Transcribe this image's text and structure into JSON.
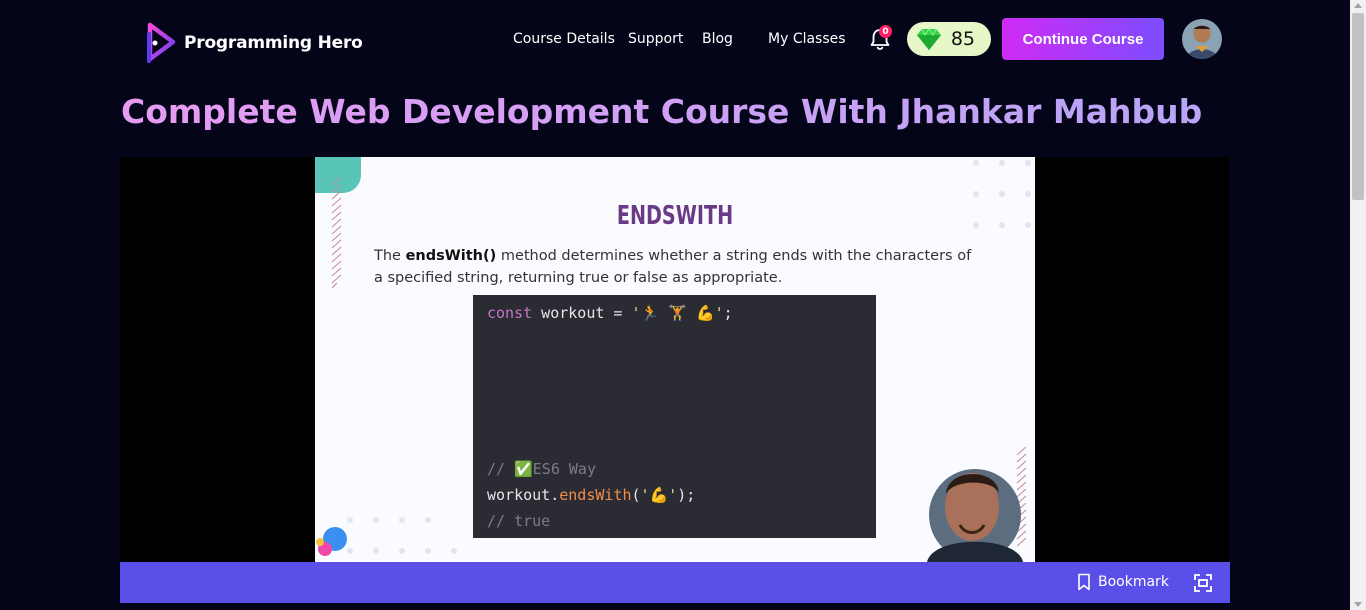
{
  "brand": {
    "name": "Programming Hero"
  },
  "nav": {
    "links": [
      "Course Details",
      "Support",
      "Blog",
      "My Classes"
    ],
    "notification_count": "0",
    "gem_count": "85",
    "continue_label": "Continue Course"
  },
  "page": {
    "title": "Complete Web Development Course With Jhankar Mahbub"
  },
  "slide": {
    "heading": "ENDSWITH",
    "desc_prefix": "The ",
    "desc_method": "endsWith()",
    "desc_rest": " method determines whether a string ends with the characters of a specified string, returning true or false as appropriate.",
    "code": {
      "line1_kw": "const",
      "line1_var": " workout = ",
      "line1_str": "'🏃 🏋 💪'",
      "line1_end": ";",
      "comment1": "// ✅ES6 Way",
      "line2_obj": "workout.",
      "line2_fn": "endsWith",
      "line2_open": "(",
      "line2_str": "'💪'",
      "line2_close": ");",
      "comment2": "// true"
    }
  },
  "controls": {
    "bookmark_label": "Bookmark"
  },
  "colors": {
    "background": "#05051a",
    "accent_gradient_start": "#d02bf5",
    "accent_gradient_end": "#7c4dff",
    "control_bar": "#5b4fea",
    "heading_purple": "#6a3a86"
  },
  "icons": [
    "logo-icon",
    "bell-icon",
    "gem-icon",
    "bookmark-icon",
    "fullscreen-icon"
  ]
}
